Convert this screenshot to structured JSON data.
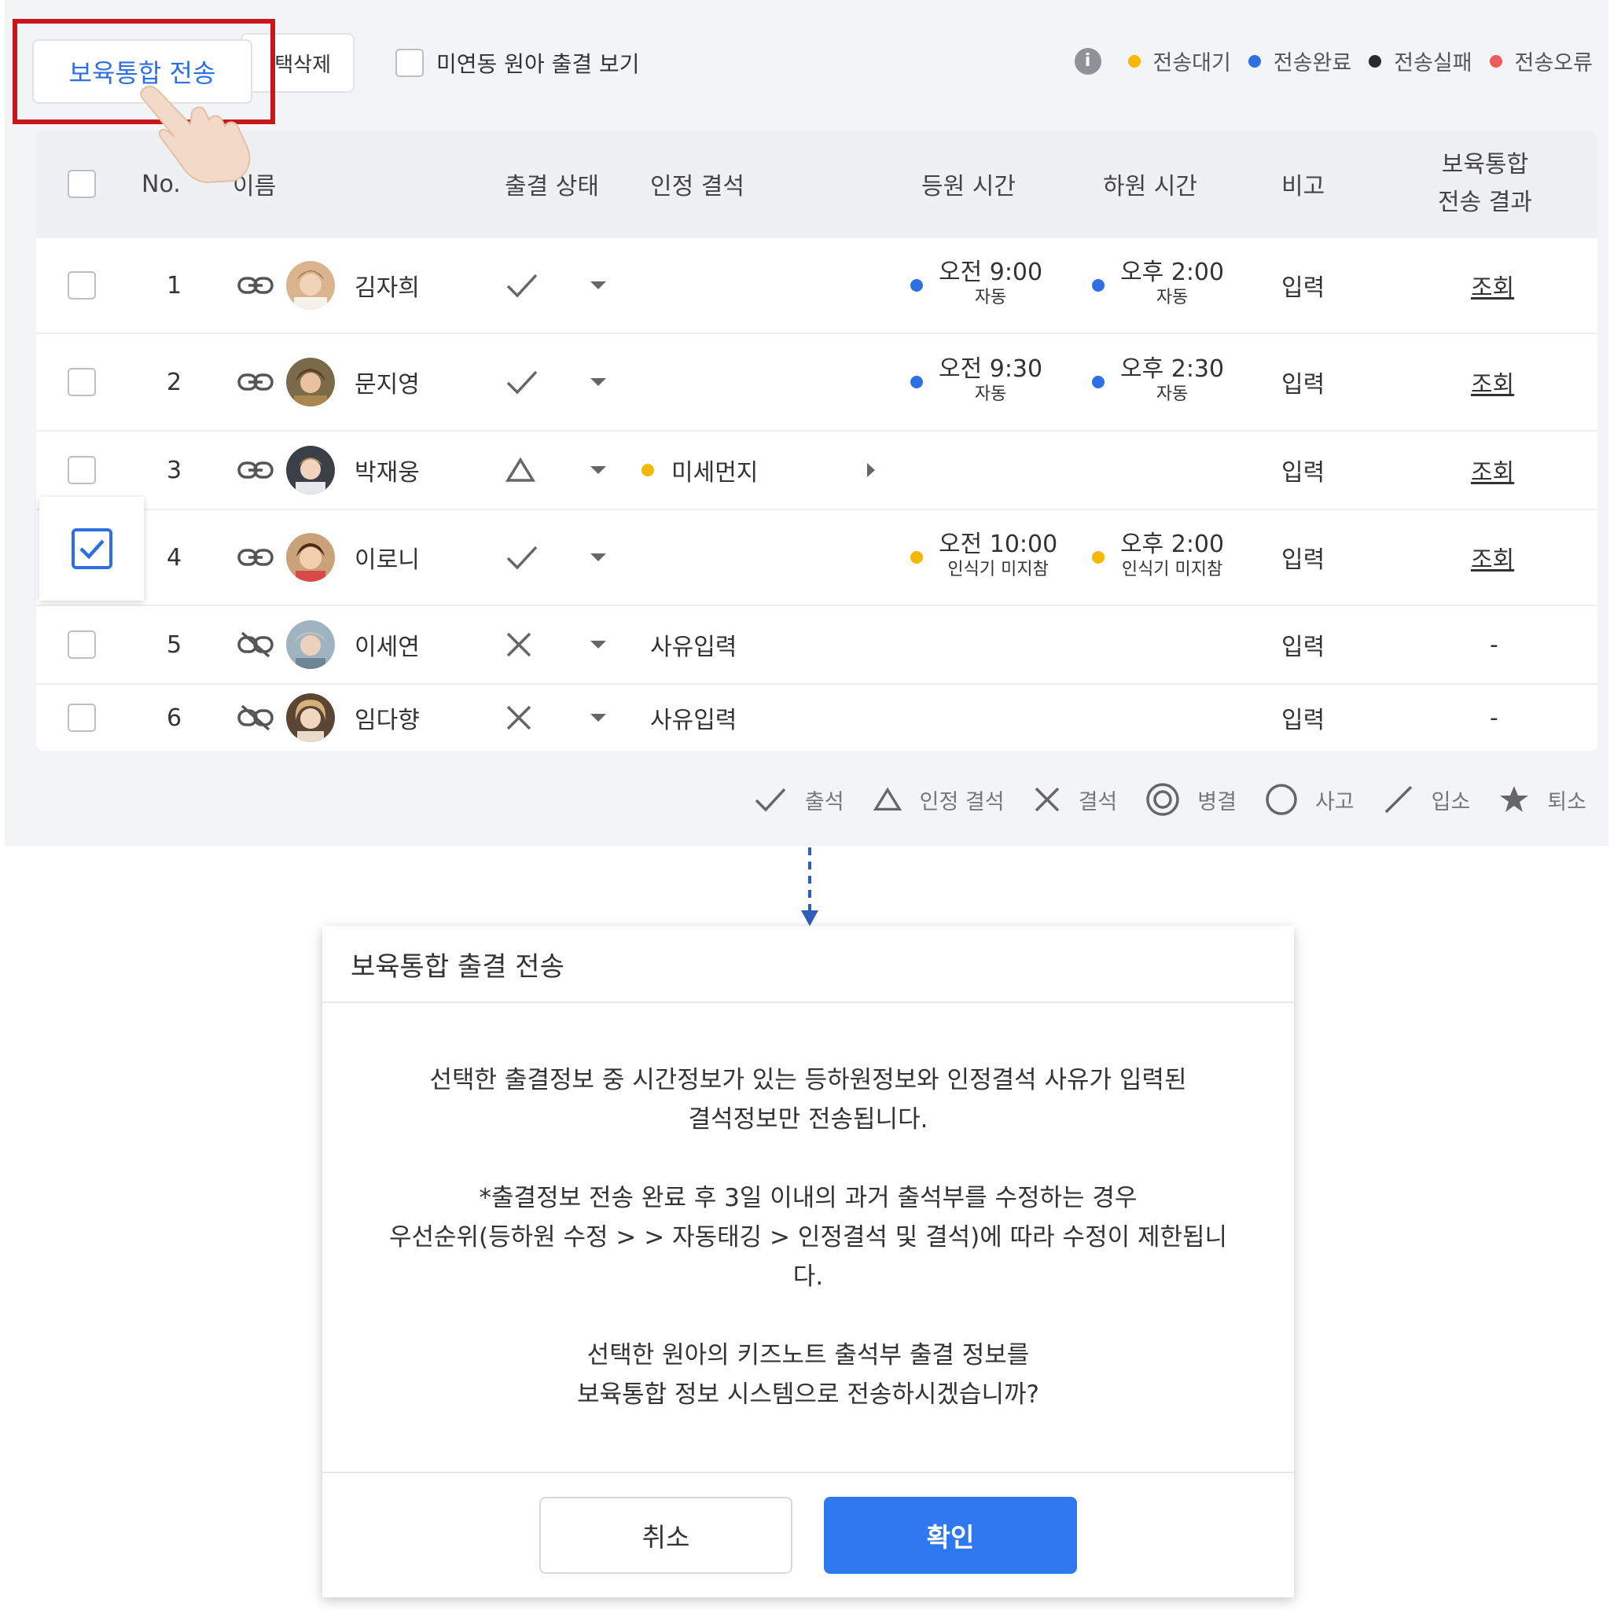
{
  "toolbar": {
    "send_button": "보육통합 전송",
    "delete_button_partial": "택삭제",
    "unlinked_label": "미연동 원아 출결 보기"
  },
  "status_legend": [
    {
      "label": "전송대기",
      "color": "#f5b800"
    },
    {
      "label": "전송완료",
      "color": "#2f6fe4"
    },
    {
      "label": "전송실패",
      "color": "#2b2b2b"
    },
    {
      "label": "전송오류",
      "color": "#f05a5a"
    }
  ],
  "table": {
    "headers": {
      "no": "No.",
      "name": "이름",
      "attendance": "출결 상태",
      "excused": "인정 결석",
      "arrival": "등원 시간",
      "departure": "하원 시간",
      "note": "비고",
      "result_line1": "보육통합",
      "result_line2": "전송 결과"
    },
    "rows": [
      {
        "no": "1",
        "name": "김자희",
        "linked": true,
        "status": "check",
        "reason": "",
        "arrival": {
          "time": "오전 9:00",
          "sub": "자동",
          "color": "#2f6fe4"
        },
        "departure": {
          "time": "오후 2:00",
          "sub": "자동",
          "color": "#2f6fe4"
        },
        "note": "입력",
        "result": "조회",
        "checked": false
      },
      {
        "no": "2",
        "name": "문지영",
        "linked": true,
        "status": "check",
        "reason": "",
        "arrival": {
          "time": "오전 9:30",
          "sub": "자동",
          "color": "#2f6fe4"
        },
        "departure": {
          "time": "오후 2:30",
          "sub": "자동",
          "color": "#2f6fe4"
        },
        "note": "입력",
        "result": "조회",
        "checked": false
      },
      {
        "no": "3",
        "name": "박재웅",
        "linked": true,
        "status": "triangle",
        "reason": "미세먼지",
        "reason_color": "#f5b800",
        "note": "입력",
        "result": "조회",
        "checked": false
      },
      {
        "no": "4",
        "name": "이로니",
        "linked": true,
        "status": "check",
        "reason": "",
        "arrival": {
          "time": "오전 10:00",
          "sub": "인식기 미지참",
          "color": "#f5b800"
        },
        "departure": {
          "time": "오후 2:00",
          "sub": "인식기 미지참",
          "color": "#f5b800"
        },
        "note": "입력",
        "result": "조회",
        "checked": true
      },
      {
        "no": "5",
        "name": "이세연",
        "linked": false,
        "status": "x",
        "reason_placeholder": "사유입력",
        "note": "입력",
        "result": "-",
        "checked": false
      },
      {
        "no": "6",
        "name": "임다향",
        "linked": false,
        "status": "x",
        "reason_placeholder": "사유입력",
        "note": "입력",
        "result": "-",
        "checked": false
      }
    ]
  },
  "mark_legend": [
    {
      "icon": "check-icon",
      "label": "출석"
    },
    {
      "icon": "triangle-icon",
      "label": "인정 결석"
    },
    {
      "icon": "x-icon",
      "label": "결석"
    },
    {
      "icon": "double-circle-icon",
      "label": "병결"
    },
    {
      "icon": "circle-icon",
      "label": "사고"
    },
    {
      "icon": "slash-icon",
      "label": "입소"
    },
    {
      "icon": "star-icon",
      "label": "퇴소"
    }
  ],
  "modal": {
    "title": "보육통합 출결 전송",
    "para1_line1": "선택한 출결정보 중 시간정보가 있는 등하원정보와 인정결석 사유가 입력된",
    "para1_line2": "결석정보만 전송됩니다.",
    "para2_line1": "*출결정보 전송 완료 후 3일 이내의 과거 출석부를 수정하는 경우",
    "para2_line2": "우선순위(등하원 수정 > > 자동태깅 > 인정결석 및 결석)에 따라 수정이 제한됩니",
    "para2_line3": "다.",
    "para3_line1": "선택한 원아의 키즈노트 출석부 출결 정보를",
    "para3_line2": "보육통합 정보 시스템으로 전송하시겠습니까?",
    "cancel_label": "취소",
    "confirm_label": "확인"
  }
}
